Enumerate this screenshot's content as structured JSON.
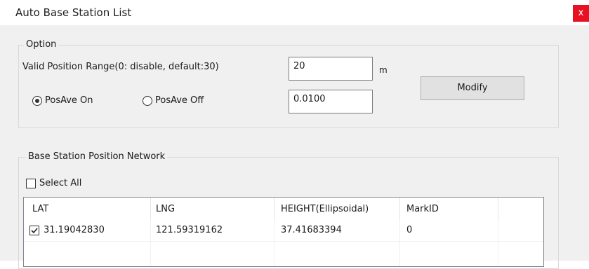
{
  "window": {
    "title": "Auto Base Station List",
    "close_glyph": "x"
  },
  "option_group": {
    "legend": "Option",
    "range_label": "Valid Position Range(0: disable, default:30)",
    "range_value": "20",
    "range_unit": "m",
    "posave_value": "0.0100",
    "radio_on_label": "PosAve On",
    "radio_off_label": "PosAve Off",
    "radio_on_selected": true,
    "modify_label": "Modify"
  },
  "network_group": {
    "legend": "Base Station Position Network",
    "select_all_label": "Select All",
    "select_all_checked": false,
    "columns": [
      "LAT",
      "LNG",
      "HEIGHT(Ellipsoidal)",
      "MarkID"
    ],
    "rows": [
      {
        "checked": true,
        "lat": "31.19042830",
        "lng": "121.59319162",
        "height": "37.41683394",
        "markid": "0"
      }
    ]
  },
  "icons": {
    "close": "close-icon",
    "check": "checkmark-icon",
    "radio": "radio-dot-icon"
  },
  "colors": {
    "close_button": "#e81123",
    "dialog_background": "#f0f0f0"
  }
}
